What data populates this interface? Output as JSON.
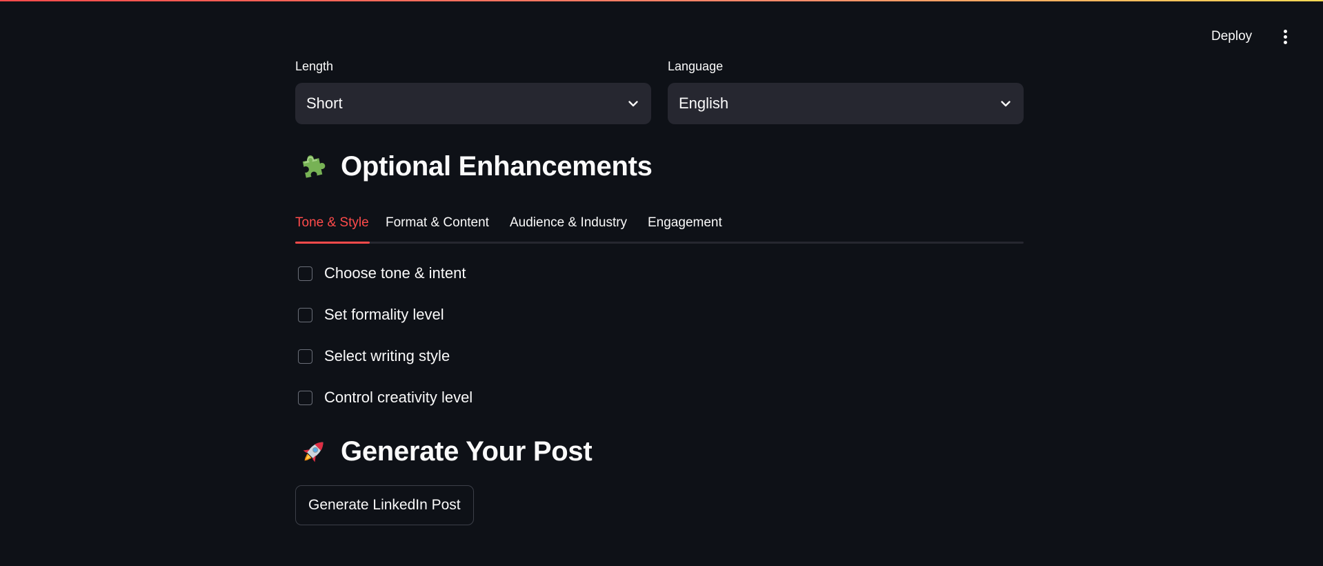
{
  "header": {
    "deploy_label": "Deploy",
    "menu_icon": "kebab-menu-icon"
  },
  "selects": {
    "length": {
      "label": "Length",
      "value": "Short"
    },
    "language": {
      "label": "Language",
      "value": "English"
    }
  },
  "enhancements": {
    "icon": "puzzle-piece-icon",
    "title": "Optional Enhancements",
    "tabs": [
      {
        "label": "Tone & Style",
        "active": true
      },
      {
        "label": "Format & Content",
        "active": false
      },
      {
        "label": "Audience & Industry",
        "active": false
      },
      {
        "label": "Engagement",
        "active": false
      }
    ],
    "options": [
      {
        "label": "Choose tone & intent",
        "checked": false
      },
      {
        "label": "Set formality level",
        "checked": false
      },
      {
        "label": "Select writing style",
        "checked": false
      },
      {
        "label": "Control creativity level",
        "checked": false
      }
    ]
  },
  "generate": {
    "icon": "rocket-icon",
    "title": "Generate Your Post",
    "button_label": "Generate LinkedIn Post"
  },
  "colors": {
    "background": "#0e1117",
    "accent": "#ff4b4b",
    "input_bg": "#262730",
    "text": "#fafafa"
  }
}
